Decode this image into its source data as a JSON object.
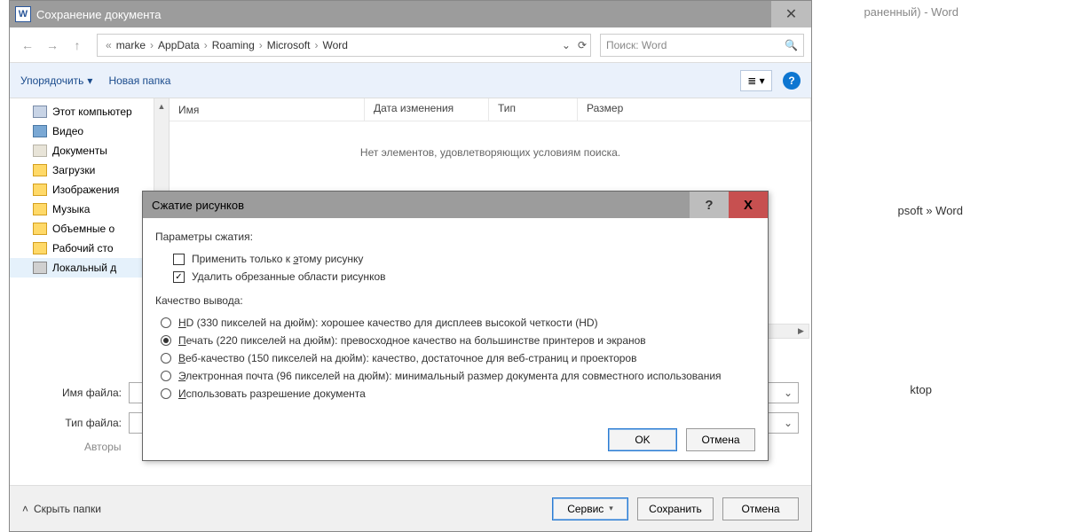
{
  "bg": {
    "title_suffix": "раненный) - Word",
    "path_tail": "psoft » Word",
    "ktop": "ktop"
  },
  "save_dialog": {
    "title": "Сохранение документа",
    "nav": {
      "breadcrumb": [
        "marke",
        "AppData",
        "Roaming",
        "Microsoft",
        "Word"
      ],
      "search_placeholder": "Поиск: Word"
    },
    "toolbar": {
      "organize": "Упорядочить",
      "new_folder": "Новая папка"
    },
    "tree": [
      {
        "label": "Этот компьютер",
        "icon": "pc"
      },
      {
        "label": "Видео",
        "icon": "vid"
      },
      {
        "label": "Документы",
        "icon": "doc"
      },
      {
        "label": "Загрузки",
        "icon": "folder"
      },
      {
        "label": "Изображения",
        "icon": "folder"
      },
      {
        "label": "Музыка",
        "icon": "folder"
      },
      {
        "label": "Объемные о",
        "icon": "folder"
      },
      {
        "label": "Рабочий сто",
        "icon": "folder"
      },
      {
        "label": "Локальный д",
        "icon": "disk"
      }
    ],
    "columns": {
      "name": "Имя",
      "date": "Дата изменения",
      "type": "Тип",
      "size": "Размер"
    },
    "empty_msg": "Нет элементов, удовлетворяющих условиям поиска.",
    "filename_label": "Имя файла:",
    "filetype_label": "Тип файла:",
    "authors_label": "Авторы",
    "hide_folders": "Скрыть папки",
    "buttons": {
      "tools": "Сервис",
      "save": "Сохранить",
      "cancel": "Отмена"
    }
  },
  "compress_dialog": {
    "title": "Сжатие рисунков",
    "section_params": "Параметры сжатия:",
    "check_apply_only": "Применить только к этому рисунку",
    "check_apply_only_u": "э",
    "check_delete_cropped": "Удалить обрезанные области рисунков",
    "section_quality": "Качество вывода:",
    "radios": [
      {
        "u": "H",
        "label": "D (330 пикселей на дюйм): хорошее качество для дисплеев высокой четкости (HD)"
      },
      {
        "u": "П",
        "label": "ечать (220 пикселей на дюйм): превосходное качество на большинстве принтеров и экранов"
      },
      {
        "u": "В",
        "label": "еб-качество (150 пикселей на дюйм): качество, достаточное для веб-страниц и проекторов"
      },
      {
        "u": "Э",
        "label": "лектронная почта (96 пикселей на дюйм): минимальный размер документа для совместного использования"
      },
      {
        "u": "И",
        "label": "спользовать разрешение документа"
      }
    ],
    "selected_radio": 1,
    "buttons": {
      "ok": "OK",
      "cancel": "Отмена"
    }
  }
}
